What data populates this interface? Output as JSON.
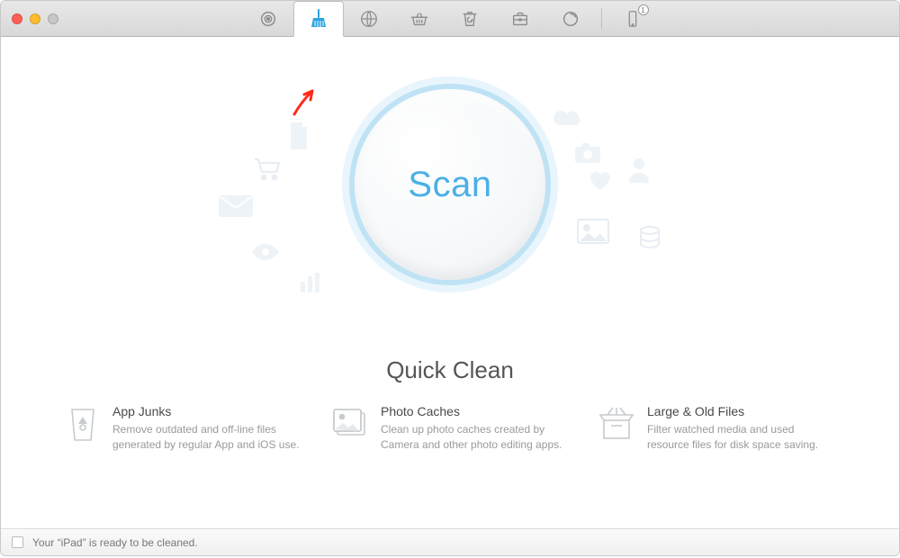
{
  "scan": {
    "label": "Scan"
  },
  "section": {
    "title": "Quick Clean"
  },
  "cards": {
    "appjunks": {
      "title": "App Junks",
      "desc": "Remove outdated and off-line files generated by regular App and iOS use."
    },
    "photocache": {
      "title": "Photo Caches",
      "desc": "Clean up photo caches created by Camera and other photo editing apps."
    },
    "largeold": {
      "title": "Large & Old Files",
      "desc": "Filter watched media and used resource files for disk space saving."
    }
  },
  "status": {
    "message": "Your “iPad” is ready to be cleaned."
  },
  "device_badge": {
    "count": "1"
  },
  "colors": {
    "accent": "#49b0e6",
    "icon_gray": "#8e8e8e"
  }
}
